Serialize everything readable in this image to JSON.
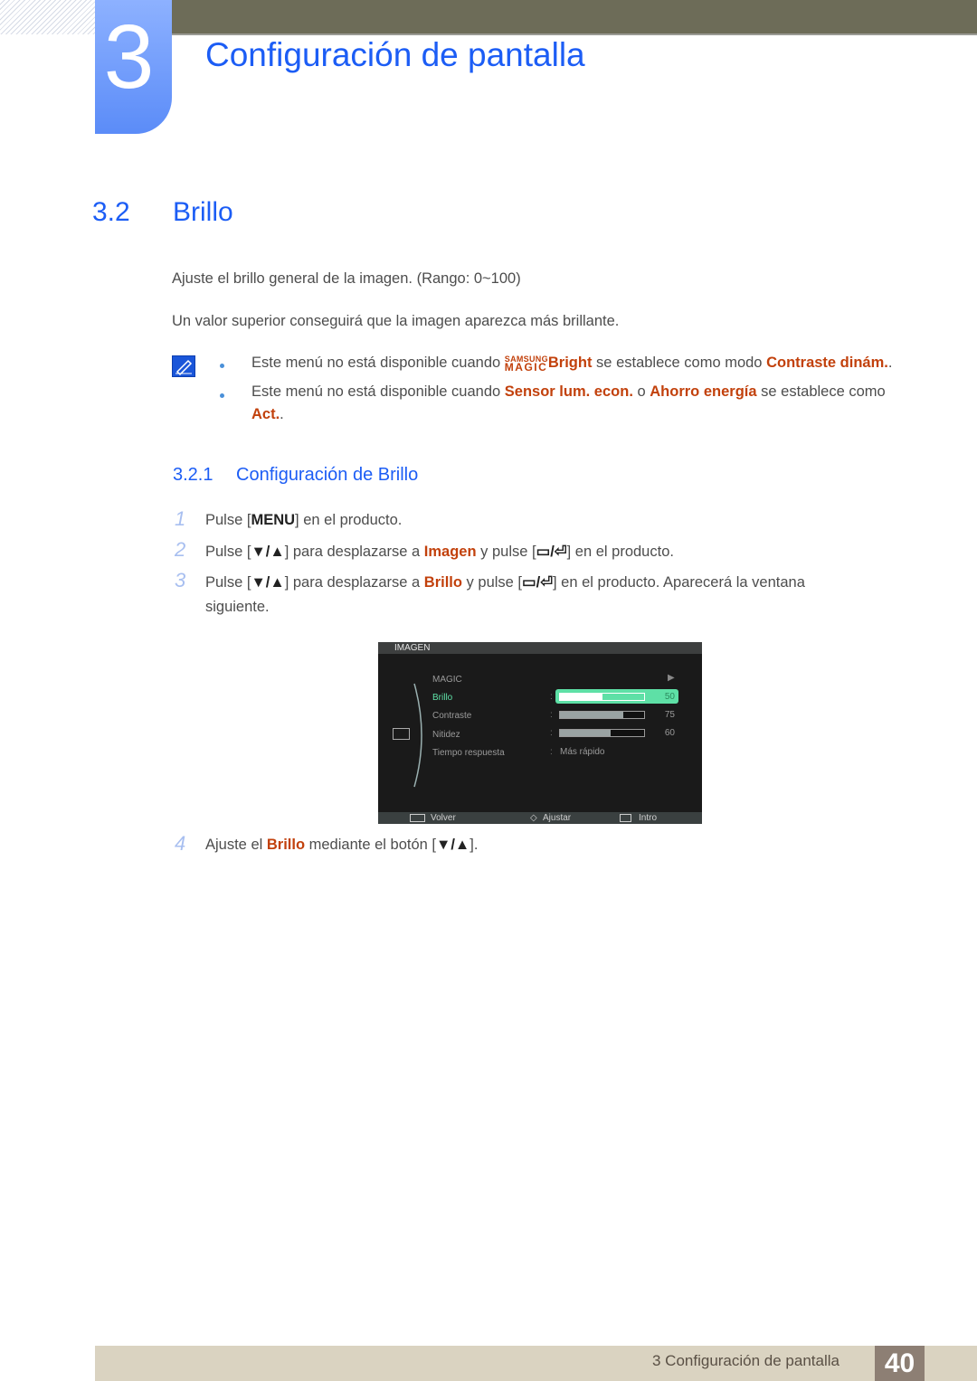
{
  "chapter": {
    "number": "3",
    "title": "Configuración de pantalla"
  },
  "section": {
    "number": "3.2",
    "title": "Brillo"
  },
  "intro": [
    "Ajuste el brillo general de la imagen. (Rango: 0~100)",
    "Un valor superior conseguirá que la imagen aparezca más brillante."
  ],
  "notes": {
    "icon": "note-pencil-icon",
    "n1": {
      "a": "Este menú no está disponible cuando ",
      "logo_top": "SAMSUNG",
      "logo_bottom": "MAGIC",
      "logo_word": "Bright",
      "b": " se establece como modo ",
      "hl": "Contraste dinám.",
      "c": "."
    },
    "n2": {
      "a": "Este menú no está disponible cuando ",
      "hl1": "Sensor lum. econ.",
      "b": " o ",
      "hl2": "Ahorro energía",
      "c": " se establece como",
      "hl3": "Act.",
      "d": "."
    }
  },
  "subsection": {
    "number": "3.2.1",
    "title": "Configuración de Brillo"
  },
  "steps": {
    "s1": {
      "num": "1",
      "a": "Pulse [",
      "key": "MENU",
      "b": "] en el producto."
    },
    "s2": {
      "num": "2",
      "a": "Pulse [",
      "key": "▼/▲",
      "b": "] para desplazarse a ",
      "hl": "Imagen",
      "c": " y pulse [",
      "key2": "▭/⏎",
      "d": "] en el producto."
    },
    "s3": {
      "num": "3",
      "a": "Pulse [",
      "key": "▼/▲",
      "b": "] para desplazarse a ",
      "hl": "Brillo",
      "c": " y pulse [",
      "key2": "▭/⏎",
      "d": "] en el producto. Aparecerá la ventana",
      "e": "siguiente."
    },
    "s4": {
      "num": "4",
      "a": "Ajuste el ",
      "hl": "Brillo",
      "b": " mediante el botón [",
      "key": "▼/▲",
      "c": "]."
    }
  },
  "osd": {
    "header": "IMAGEN",
    "items": [
      {
        "label": "MAGIC",
        "arrow": "▶"
      },
      {
        "label": "Brillo",
        "value": "50",
        "level": 50
      },
      {
        "label": "Contraste",
        "value": "75",
        "level": 75
      },
      {
        "label": "Nitidez",
        "value": "60",
        "level": 60
      },
      {
        "label": "Tiempo respuesta",
        "text": "Más rápido"
      }
    ],
    "footer": {
      "back": "Volver",
      "adjust": "Ajustar",
      "enter": "Intro"
    }
  },
  "footer": {
    "text": "3 Configuración de pantalla",
    "page": "40"
  }
}
